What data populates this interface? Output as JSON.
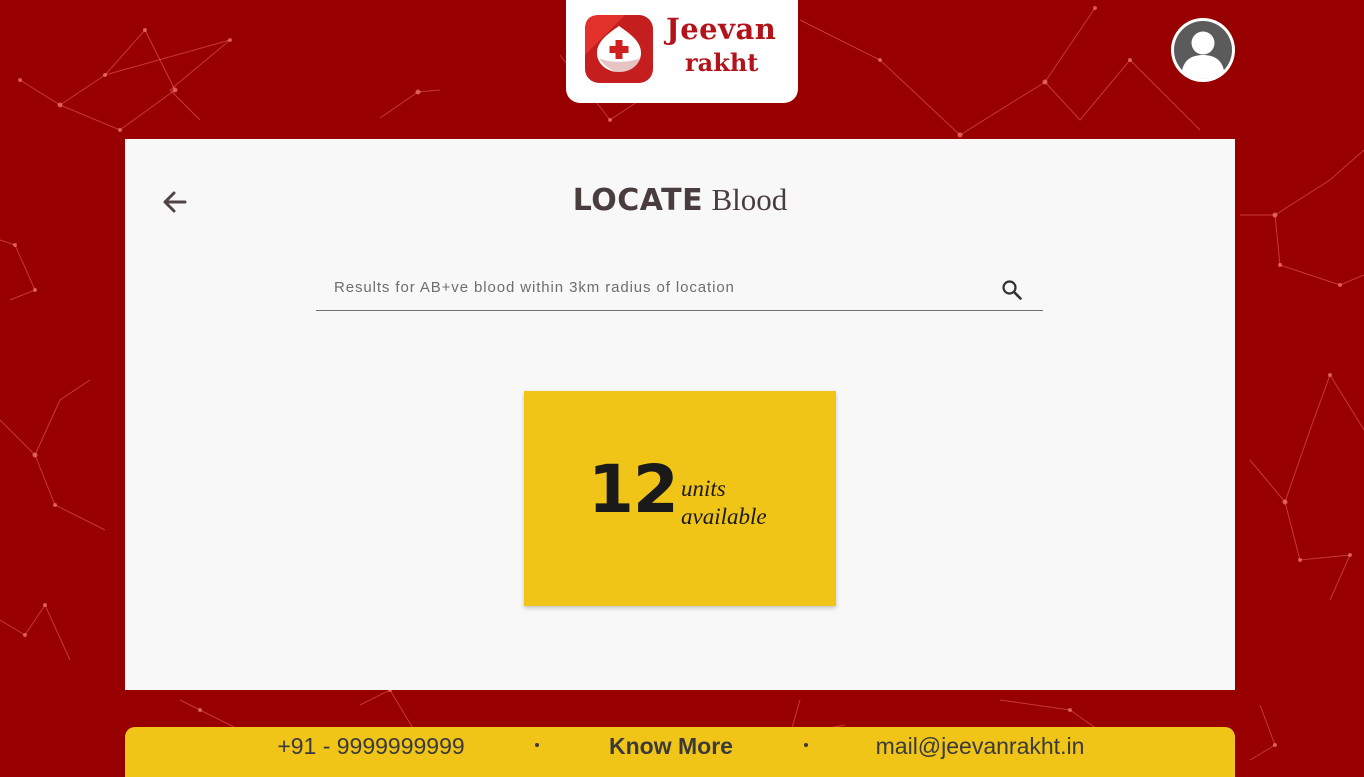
{
  "brand": {
    "name_line1": "Jeevan",
    "name_line2": "rakht"
  },
  "header": {
    "avatar_icon": "user-avatar-icon"
  },
  "page": {
    "back_icon": "arrow-left-icon",
    "title_bold": "LOCATE",
    "title_light": "Blood"
  },
  "search": {
    "value": "Results for AB+ve blood within 3km radius of location",
    "icon": "search-icon"
  },
  "result": {
    "count": "12",
    "label_line1": "units",
    "label_line2": "available"
  },
  "footer": {
    "phone": "+91 - 9999999999",
    "know_more": "Know More",
    "email": "mail@jeevanrakht.in"
  },
  "colors": {
    "background": "#980000",
    "brand_red": "#b3141b",
    "accent_yellow": "#f0c518",
    "panel": "#f8f8f8",
    "title_text": "#4a3d3d"
  }
}
